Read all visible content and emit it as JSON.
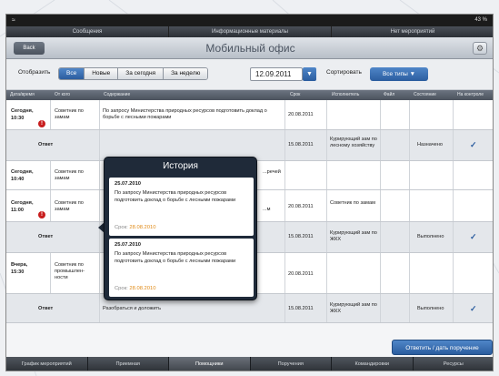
{
  "status": {
    "battery": "43 %"
  },
  "topnav": {
    "items": [
      "Сообщения",
      "Информационные материалы",
      "Нет мероприятий"
    ]
  },
  "titlebar": {
    "back": "Back",
    "title": "Мобильный офис"
  },
  "filter": {
    "show_label": "Отобразить",
    "segments": [
      "Все",
      "Новые",
      "За сегодня",
      "За неделю"
    ],
    "active": "Все",
    "date": "12.09.2011",
    "sort_label": "Сортировать",
    "types": "Все типы"
  },
  "table": {
    "headers": [
      "Дата/время",
      "От кого",
      "Содержание",
      "Срок",
      "Исполнитель",
      "Файл",
      "Состояние",
      "На контроле"
    ],
    "rows": [
      {
        "date": "Сегодня,",
        "time": "10:30",
        "from": "Советник по замам",
        "content": "По запросу Министерства природных ресурсов подготовить доклад о борьбе с лесными пожарами",
        "due": "20.08.2011"
      },
      {
        "answer": "Ответ",
        "due": "15.08.2011",
        "executor": "Курирующий зам по лесному хозяйству",
        "state": "Назначено",
        "check": "✓"
      },
      {
        "date": "Сегодня,",
        "time": "10:40",
        "from": "Советник по замам",
        "content": "...речей"
      },
      {
        "date": "Сегодня,",
        "time": "11:00",
        "from": "Советник по замам",
        "content": "...м",
        "due": "20.08.2011",
        "executor": "Советник по замам"
      },
      {
        "answer": "Ответ",
        "due": "15.08.2011",
        "executor": "Курирующий зам по ЖКХ",
        "state": "Выполнено",
        "check": "✓"
      },
      {
        "date": "Вчера,",
        "time": "15:30",
        "from": "Советник по промышлен-ности",
        "due": "20.08.2011"
      },
      {
        "answer": "Ответ",
        "content": "Разобраться и доложить",
        "due": "15.08.2011",
        "executor": "Курирующий зам по ЖКХ",
        "state": "Выполнено",
        "check": "✓"
      }
    ]
  },
  "popover": {
    "title": "История",
    "cards": [
      {
        "date": "25.07.2010",
        "text": "По запросу Министерства природных ресурсов подготовить доклад о борьбе с лесными пожарами",
        "due_label": "Срок:",
        "due": "28.08.2010"
      },
      {
        "date": "25.07.2010",
        "text": "По запросу Министерства природных ресурсов подготовить доклад о борьбе с лесными пожарами",
        "due_label": "Срок:",
        "due": "28.08.2010"
      }
    ]
  },
  "reply_button": "Ответить / дать поручение",
  "tabbar": {
    "items": [
      "График мероприятий",
      "Приемная",
      "Помощники",
      "Поручения",
      "Командировки",
      "Ресурсы"
    ],
    "active": "Помощники"
  }
}
